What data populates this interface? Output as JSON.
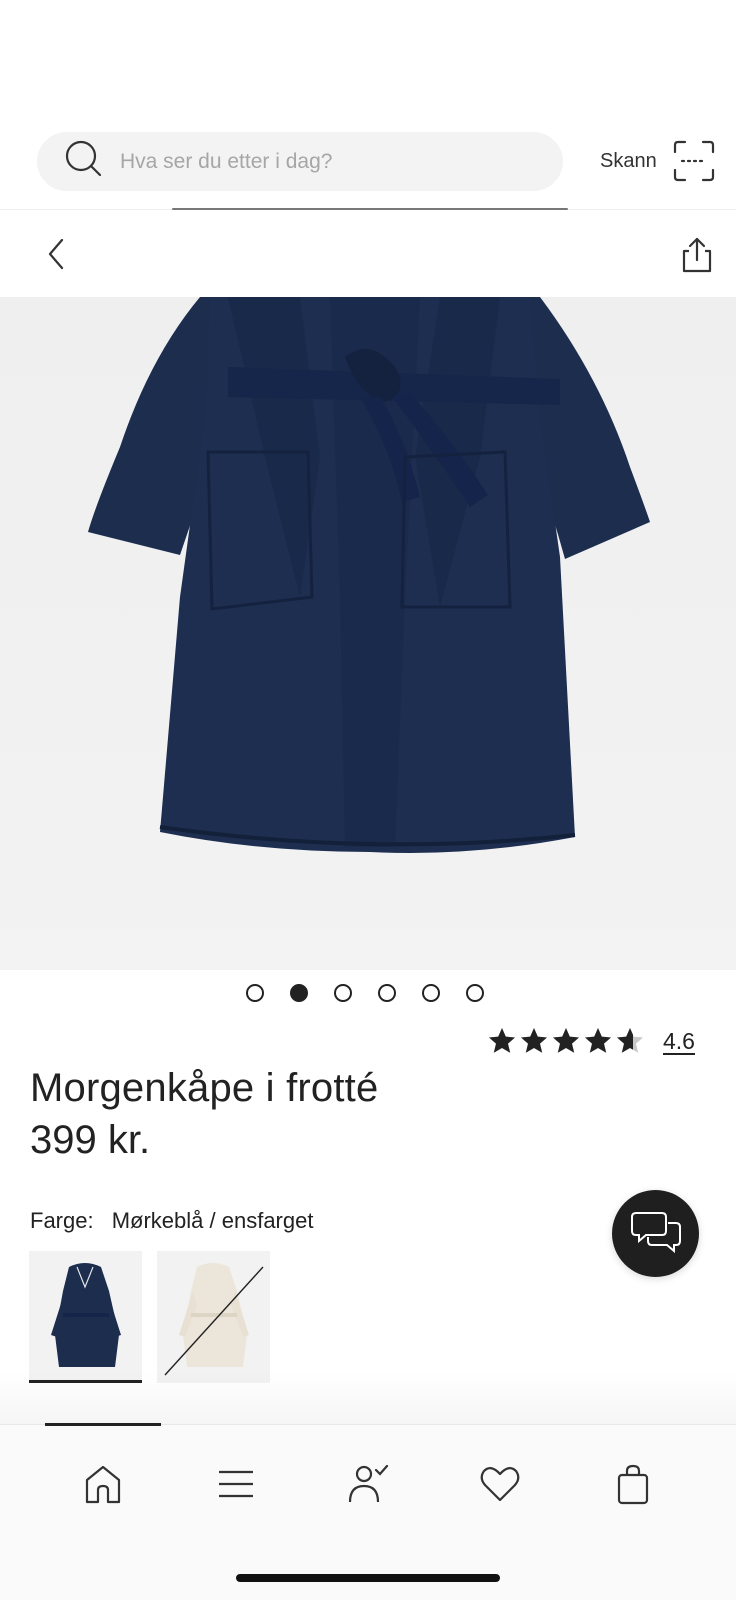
{
  "search": {
    "placeholder": "Hva ser du etter i dag?",
    "scan_label": "Skann"
  },
  "carousel": {
    "count": 6,
    "active_index": 1
  },
  "product": {
    "title": "Morgenkåpe i frotté",
    "price": "399 kr.",
    "rating_value": "4.6",
    "rating": 4.6,
    "color_label": "Farge:",
    "color_value": "Mørkeblå / ensfarget"
  },
  "swatches": [
    {
      "name": "Mørkeblå",
      "color": "#1c2d4e",
      "selected": true,
      "available": true
    },
    {
      "name": "Hvit",
      "color": "#ece6da",
      "selected": false,
      "available": false
    }
  ],
  "colors": {
    "robe": "#1c2d4e",
    "text": "#222222",
    "accent": "#1f1f1f"
  },
  "bottom_nav": {
    "items": [
      "home-icon",
      "menu-icon",
      "account-icon",
      "heart-icon",
      "bag-icon"
    ],
    "active_index": 0
  }
}
